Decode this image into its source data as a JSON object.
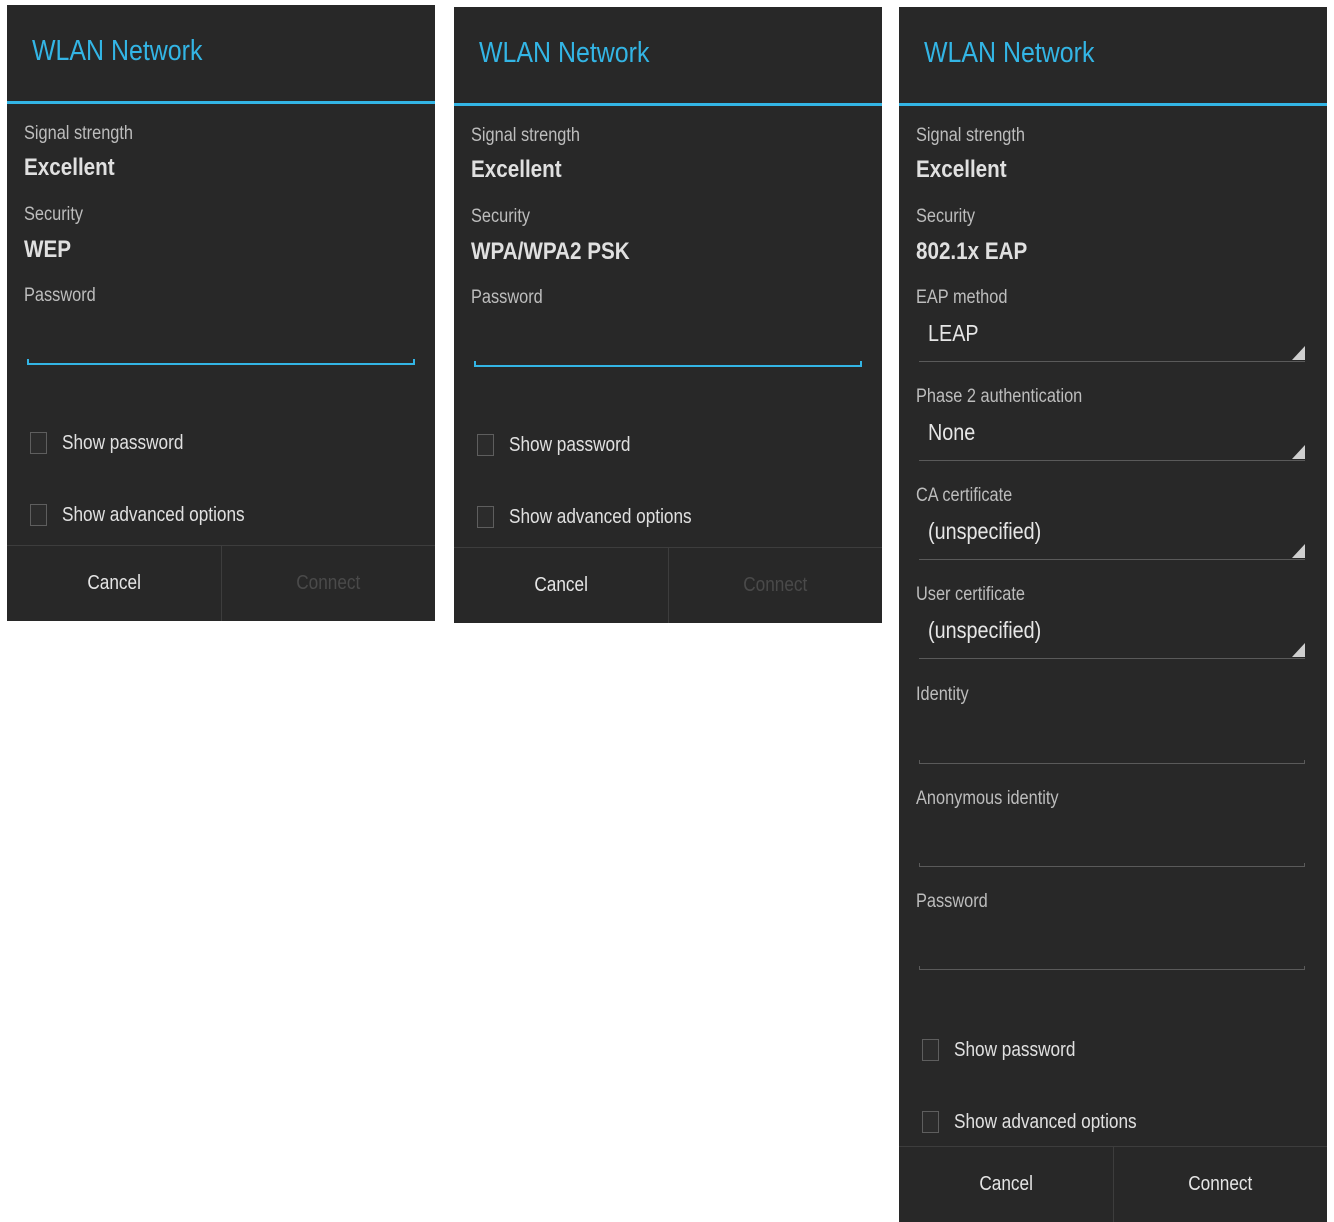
{
  "dialogs": [
    {
      "title": "WLAN Network",
      "signal_label": "Signal strength",
      "signal_value": "Excellent",
      "security_label": "Security",
      "security_value": "WEP",
      "password_label": "Password",
      "password_value": "",
      "show_password": "Show password",
      "show_advanced": "Show advanced options",
      "cancel": "Cancel",
      "connect": "Connect",
      "connect_enabled": false
    },
    {
      "title": "WLAN Network",
      "signal_label": "Signal strength",
      "signal_value": "Excellent",
      "security_label": "Security",
      "security_value": "WPA/WPA2 PSK",
      "password_label": "Password",
      "password_value": "",
      "show_password": "Show password",
      "show_advanced": "Show advanced options",
      "cancel": "Cancel",
      "connect": "Connect",
      "connect_enabled": false
    },
    {
      "title": "WLAN Network",
      "signal_label": "Signal strength",
      "signal_value": "Excellent",
      "security_label": "Security",
      "security_value": "802.1x EAP",
      "eap_method_label": "EAP method",
      "eap_method_value": "LEAP",
      "phase2_label": "Phase 2 authentication",
      "phase2_value": "None",
      "ca_cert_label": "CA certificate",
      "ca_cert_value": "(unspecified)",
      "user_cert_label": "User certificate",
      "user_cert_value": "(unspecified)",
      "identity_label": "Identity",
      "anon_identity_label": "Anonymous identity",
      "password_label": "Password",
      "show_password": "Show password",
      "show_advanced": "Show advanced options",
      "cancel": "Cancel",
      "connect": "Connect",
      "connect_enabled": true
    }
  ],
  "colors": {
    "accent": "#33b5e5",
    "dialog_bg": "#282828",
    "disabled_text": "#4a4a4a"
  }
}
